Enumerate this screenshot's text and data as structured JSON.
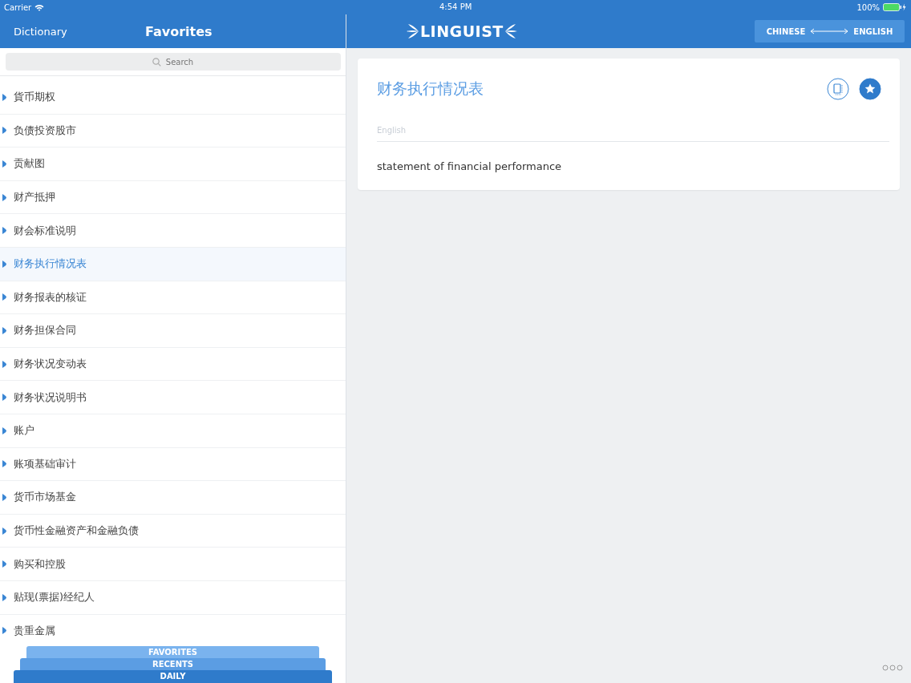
{
  "status_bar": {
    "carrier": "Carrier",
    "time": "4:54 PM",
    "battery": "100%"
  },
  "sidebar": {
    "back": "Dictionary",
    "title": "Favorites",
    "search": {
      "placeholder": "Search"
    },
    "items": [
      {
        "label": "貨币期权",
        "selected": false
      },
      {
        "label": "负债投资股市",
        "selected": false
      },
      {
        "label": "贡献图",
        "selected": false
      },
      {
        "label": "财产抵押",
        "selected": false
      },
      {
        "label": "财会标准说明",
        "selected": false
      },
      {
        "label": "财务执行情况表",
        "selected": true
      },
      {
        "label": "财务报表的核证",
        "selected": false
      },
      {
        "label": "财务担保合同",
        "selected": false
      },
      {
        "label": "财务状况变动表",
        "selected": false
      },
      {
        "label": "财务状况说明书",
        "selected": false
      },
      {
        "label": "账户",
        "selected": false
      },
      {
        "label": "账项基础审计",
        "selected": false
      },
      {
        "label": "货币市场基金",
        "selected": false
      },
      {
        "label": "货币性金融资产和金融负债",
        "selected": false
      },
      {
        "label": "购买和控股",
        "selected": false
      },
      {
        "label": "贴现(票据)经纪人",
        "selected": false
      },
      {
        "label": "贵重金属",
        "selected": false
      }
    ]
  },
  "header": {
    "logo": "LINGUIST",
    "language_toggle": {
      "from": "CHINESE",
      "to": "ENGLISH"
    }
  },
  "entry": {
    "term": "财务执行情况表",
    "favorite": true,
    "field_label": "English",
    "translation": "statement of financial performance"
  },
  "bottom_tabs": [
    "FAVORITES",
    "RECENTS",
    "DAILY"
  ]
}
